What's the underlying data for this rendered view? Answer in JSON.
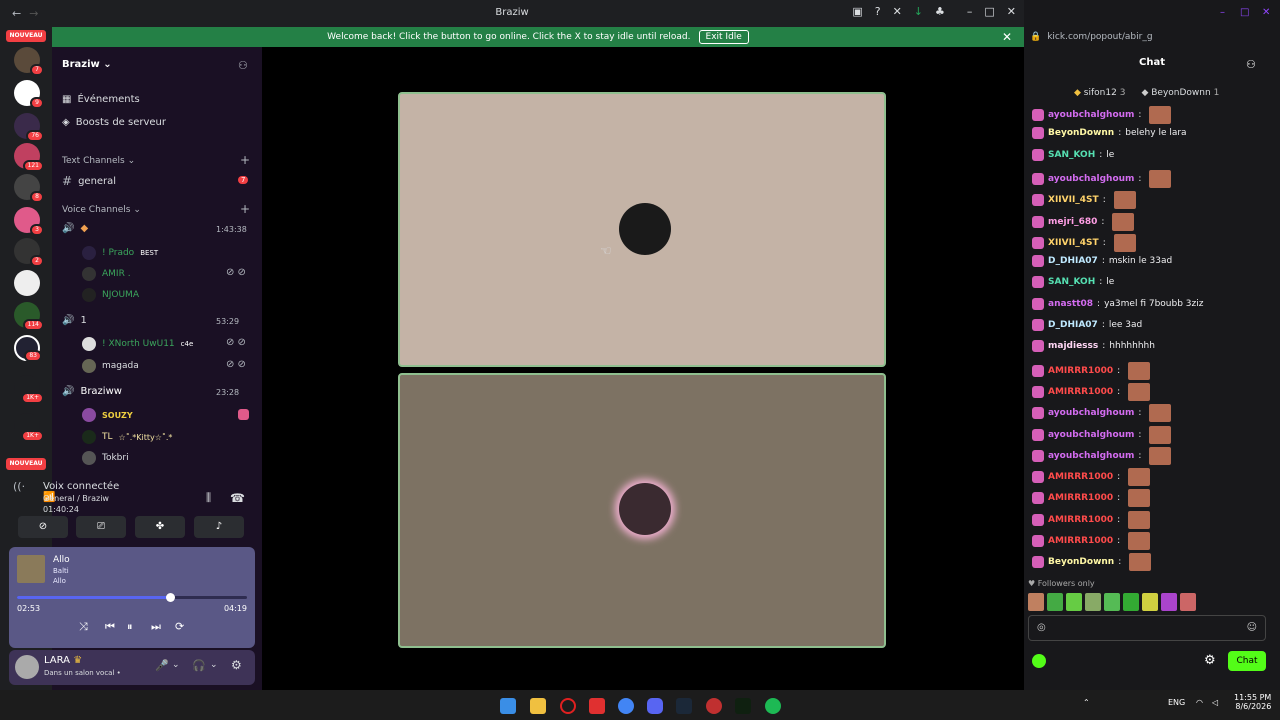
{
  "titlebar": {
    "title": "Braziw"
  },
  "banner": {
    "text": "Welcome back! Click the button to go online. Click the X to stay idle until reload.",
    "button": "Exit Idle"
  },
  "rail": {
    "nouveau_top": "NOUVEAU",
    "nouveau_bottom": "NOUVEAU",
    "badges": [
      "7",
      "9",
      "76",
      "121",
      "8",
      "3",
      "2",
      "114",
      "83",
      "1K+",
      "1K+"
    ]
  },
  "sidebar": {
    "guild_name": "Braziw",
    "events": "Événements",
    "boosts": "Boosts de serveur",
    "text_category": "Text Channels",
    "general": "general",
    "general_badge": "7",
    "voice_category": "Voice Channels",
    "voice": [
      {
        "name": "",
        "time": "1:43:38",
        "users": [
          {
            "name": "! Prado",
            "tag": "BEST"
          },
          {
            "name": "AMIR ."
          },
          {
            "name": "NJOUMA"
          }
        ]
      },
      {
        "name": "1",
        "time": "53:29",
        "users": [
          {
            "name": "! XNorth UwU11",
            "tag": "c4e"
          },
          {
            "name": "magada"
          }
        ]
      },
      {
        "name": "Braziww",
        "time": "23:28",
        "users": [
          {
            "name": "SOUZY"
          },
          {
            "name": "TL",
            "tag": "☆˚.*Kitty☆˚.*"
          },
          {
            "name": "Tokbri"
          }
        ]
      }
    ]
  },
  "voice_connected": {
    "title": "Voix connectée",
    "channel": "General / Braziw",
    "timer": "01:40:24"
  },
  "music": {
    "title": "Allo",
    "artist": "Balti",
    "album": "Allo",
    "elapsed": "02:53",
    "duration": "04:19",
    "progress": 0.667
  },
  "user_panel": {
    "name": "LARA",
    "status": "Dans un salon vocal •"
  },
  "chat": {
    "url": "kick.com/popout/abir_g",
    "tab": "Chat",
    "pinned": [
      {
        "name": "sifon12",
        "count": "3"
      },
      {
        "name": "BeyonDownn",
        "count": "1"
      }
    ],
    "messages": [
      {
        "user": "ayoubchalghoum",
        "text": "",
        "color": "#d36cf0"
      },
      {
        "user": "BeyonDownn",
        "text": "belehy le lara",
        "color": "#fff8a6"
      },
      {
        "user": "SAN_KOH",
        "text": "le",
        "color": "#56e0b2"
      },
      {
        "user": "ayoubchalghoum",
        "text": "",
        "color": "#d36cf0"
      },
      {
        "user": "XIIVII_4ST",
        "text": "",
        "color": "#ffd36b"
      },
      {
        "user": "mejri_680",
        "text": "",
        "color": "#ff9ee5"
      },
      {
        "user": "XIIVII_4ST",
        "text": "",
        "color": "#ffd36b"
      },
      {
        "user": "D_DHIA07",
        "text": "mskin le 33ad",
        "color": "#bfe9ff"
      },
      {
        "user": "SAN_KOH",
        "text": "le",
        "color": "#56e0b2"
      },
      {
        "user": "anastt08",
        "text": "ya3mel fi 7boubb 3ziz",
        "color": "#d36cf0"
      },
      {
        "user": "D_DHIA07",
        "text": "lee 3ad",
        "color": "#bfe9ff"
      },
      {
        "user": "majdiesss",
        "text": "hhhhhhhh",
        "color": "#ffd6f5"
      },
      {
        "user": "AMIRRR1000",
        "text": "",
        "color": "#ff4b4b"
      },
      {
        "user": "AMIRRR1000",
        "text": "",
        "color": "#ff4b4b"
      },
      {
        "user": "ayoubchalghoum",
        "text": "",
        "color": "#d36cf0"
      },
      {
        "user": "ayoubchalghoum",
        "text": "",
        "color": "#d36cf0"
      },
      {
        "user": "ayoubchalghoum",
        "text": "",
        "color": "#d36cf0"
      },
      {
        "user": "AMIRRR1000",
        "text": "",
        "color": "#ff4b4b"
      },
      {
        "user": "AMIRRR1000",
        "text": "",
        "color": "#ff4b4b"
      },
      {
        "user": "AMIRRR1000",
        "text": "",
        "color": "#ff4b4b"
      },
      {
        "user": "AMIRRR1000",
        "text": "",
        "color": "#ff4b4b"
      },
      {
        "user": "BeyonDownn",
        "text": "",
        "color": "#fff8a6"
      }
    ],
    "followers_only": "Followers only",
    "send_button": "Chat"
  },
  "taskbar": {
    "lang": "ENG",
    "time": "11:55 PM",
    "date": "8/6/2026"
  }
}
